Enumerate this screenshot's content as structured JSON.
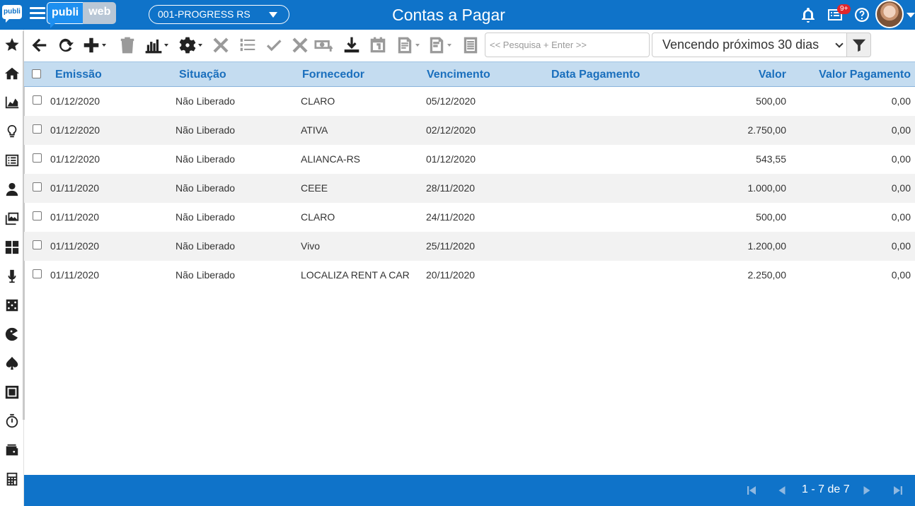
{
  "sidebar": {
    "logo_text": "publi",
    "icons": [
      "star-icon",
      "home-icon",
      "area-chart-icon",
      "lightbulb-icon",
      "list-icon",
      "user-tie-icon",
      "images-icon",
      "cmyk-icon",
      "microphone-icon",
      "dice-icon",
      "pacman-icon",
      "spade-icon",
      "square-icon",
      "stopwatch-icon",
      "wallet-icon",
      "calculator-icon",
      "checklist-icon"
    ]
  },
  "header": {
    "brand_left": "publi",
    "brand_right": "web",
    "company": "001-PROGRESS RS",
    "title": "Contas a Pagar",
    "notifications_badge": "9+",
    "accent_color": "#0f73c9"
  },
  "toolbar": {
    "search_placeholder": "<< Pesquisa + Enter >>",
    "period": "Vencendo próximos 30 dias"
  },
  "table": {
    "columns": [
      "Emissão",
      "Situação",
      "Fornecedor",
      "Vencimento",
      "Data Pagamento",
      "Valor",
      "Valor Pagamento"
    ],
    "rows": [
      {
        "emissao": "01/12/2020",
        "situacao": "Não Liberado",
        "fornecedor": "CLARO",
        "vencimento": "05/12/2020",
        "data_pagamento": "",
        "valor": "500,00",
        "valor_pagamento": "0,00"
      },
      {
        "emissao": "01/12/2020",
        "situacao": "Não Liberado",
        "fornecedor": "ATIVA",
        "vencimento": "02/12/2020",
        "data_pagamento": "",
        "valor": "2.750,00",
        "valor_pagamento": "0,00"
      },
      {
        "emissao": "01/12/2020",
        "situacao": "Não Liberado",
        "fornecedor": "ALIANCA-RS",
        "vencimento": "01/12/2020",
        "data_pagamento": "",
        "valor": "543,55",
        "valor_pagamento": "0,00"
      },
      {
        "emissao": "01/11/2020",
        "situacao": "Não Liberado",
        "fornecedor": "CEEE",
        "vencimento": "28/11/2020",
        "data_pagamento": "",
        "valor": "1.000,00",
        "valor_pagamento": "0,00"
      },
      {
        "emissao": "01/11/2020",
        "situacao": "Não Liberado",
        "fornecedor": "CLARO",
        "vencimento": "24/11/2020",
        "data_pagamento": "",
        "valor": "500,00",
        "valor_pagamento": "0,00"
      },
      {
        "emissao": "01/11/2020",
        "situacao": "Não Liberado",
        "fornecedor": "Vivo",
        "vencimento": "25/11/2020",
        "data_pagamento": "",
        "valor": "1.200,00",
        "valor_pagamento": "0,00"
      },
      {
        "emissao": "01/11/2020",
        "situacao": "Não Liberado",
        "fornecedor": "LOCALIZA RENT A CAR",
        "vencimento": "20/11/2020",
        "data_pagamento": "",
        "valor": "2.250,00",
        "valor_pagamento": "0,00"
      }
    ]
  },
  "footer": {
    "pagination": "1 - 7 de 7"
  }
}
